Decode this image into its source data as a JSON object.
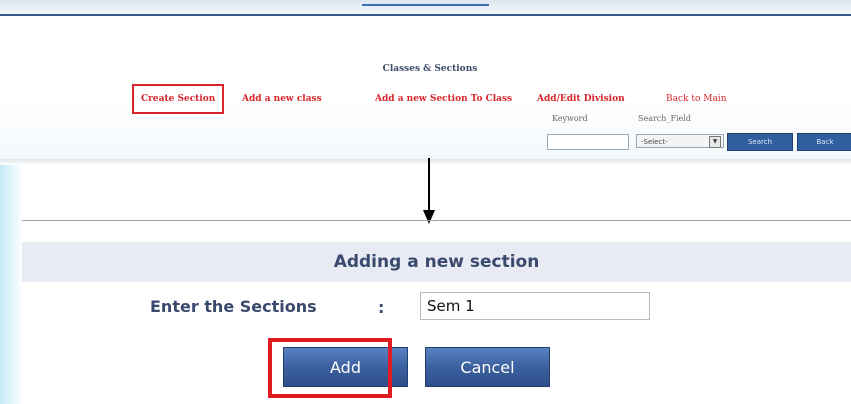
{
  "top_panel": {
    "title": "Classes & Sections",
    "menu": [
      {
        "label": "Create Section"
      },
      {
        "label": "Add a new class"
      },
      {
        "label": "Add a new Section To Class"
      },
      {
        "label": "Add/Edit Division"
      },
      {
        "label": "Back to Main"
      }
    ],
    "keyword_label": "Keyword",
    "search_field_label": "Search_Field",
    "select_value": "-Select-",
    "search_button": "Search",
    "back_button": "Back"
  },
  "form": {
    "header": "Adding a new section",
    "field_label": "Enter the Sections",
    "colon": ":",
    "field_value": "Sem 1",
    "add_button": "Add",
    "cancel_button": "Cancel"
  },
  "colors": {
    "highlight_red": "#e01b22",
    "menu_red": "#d8262a",
    "button_blue": "#3c609f",
    "header_bg": "#e8ebf3",
    "header_text": "#3a4a6e"
  },
  "icons": {
    "arrow": "down-arrow-icon",
    "select_arrow": "chevron-down-icon"
  }
}
